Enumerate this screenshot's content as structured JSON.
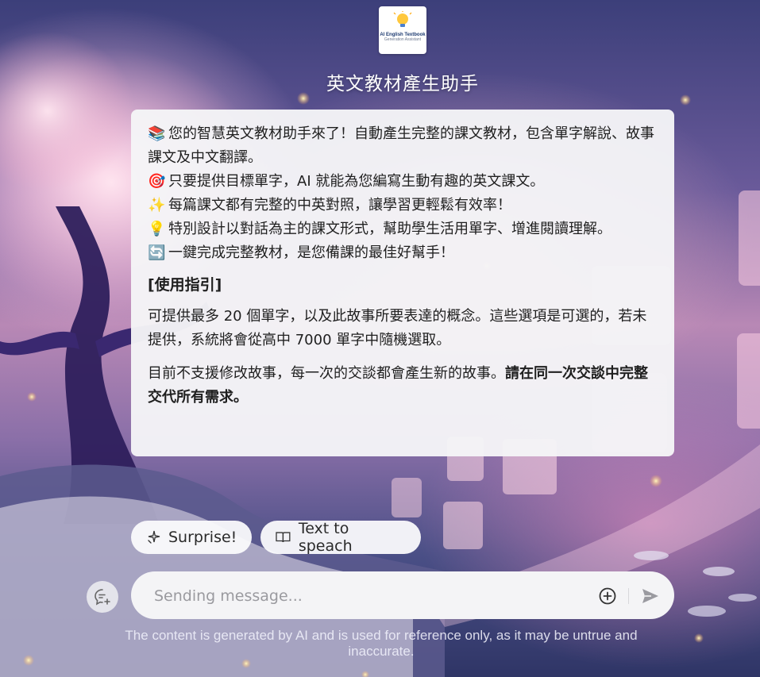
{
  "logo": {
    "line1": "AI English Textbook",
    "line2": "Generation Assistant"
  },
  "app_title": "英文教材產生助手",
  "message": {
    "lines": [
      {
        "emoji": "📚",
        "text": "您的智慧英文教材助手來了！自動產生完整的課文教材，包含單字解說、故事課文及中文翻譯。"
      },
      {
        "emoji": "🎯",
        "text": "只要提供目標單字，AI 就能為您編寫生動有趣的英文課文。"
      },
      {
        "emoji": "✨",
        "text": "每篇課文都有完整的中英對照，讓學習更輕鬆有效率！"
      },
      {
        "emoji": "💡",
        "text": "特別設計以對話為主的課文形式，幫助學生活用單字、增進閱讀理解。"
      },
      {
        "emoji": "🔄",
        "text": "一鍵完成完整教材，是您備課的最佳好幫手！"
      }
    ],
    "heading": "[使用指引]",
    "para1": "可提供最多 20 個單字，以及此故事所要表達的概念。這些選項是可選的，若未提供，系統將會從高中 7000 單字中隨機選取。",
    "para2_normal": "目前不支援修改故事，每一次的交談都會產生新的故事。",
    "para2_bold": "請在同一次交談中完整交代所有需求。"
  },
  "suggestions": [
    {
      "label": "Surprise!",
      "icon": "sparkle-icon"
    },
    {
      "label": "Text to speach",
      "icon": "book-open-icon"
    }
  ],
  "composer": {
    "placeholder": "Sending message...",
    "value": "",
    "new_chat_icon": "new-chat-icon",
    "attach_icon": "plus-circle-icon",
    "send_icon": "send-icon"
  },
  "disclaimer": "The content is generated by AI and is used for reference only, as it may be untrue and inaccurate."
}
